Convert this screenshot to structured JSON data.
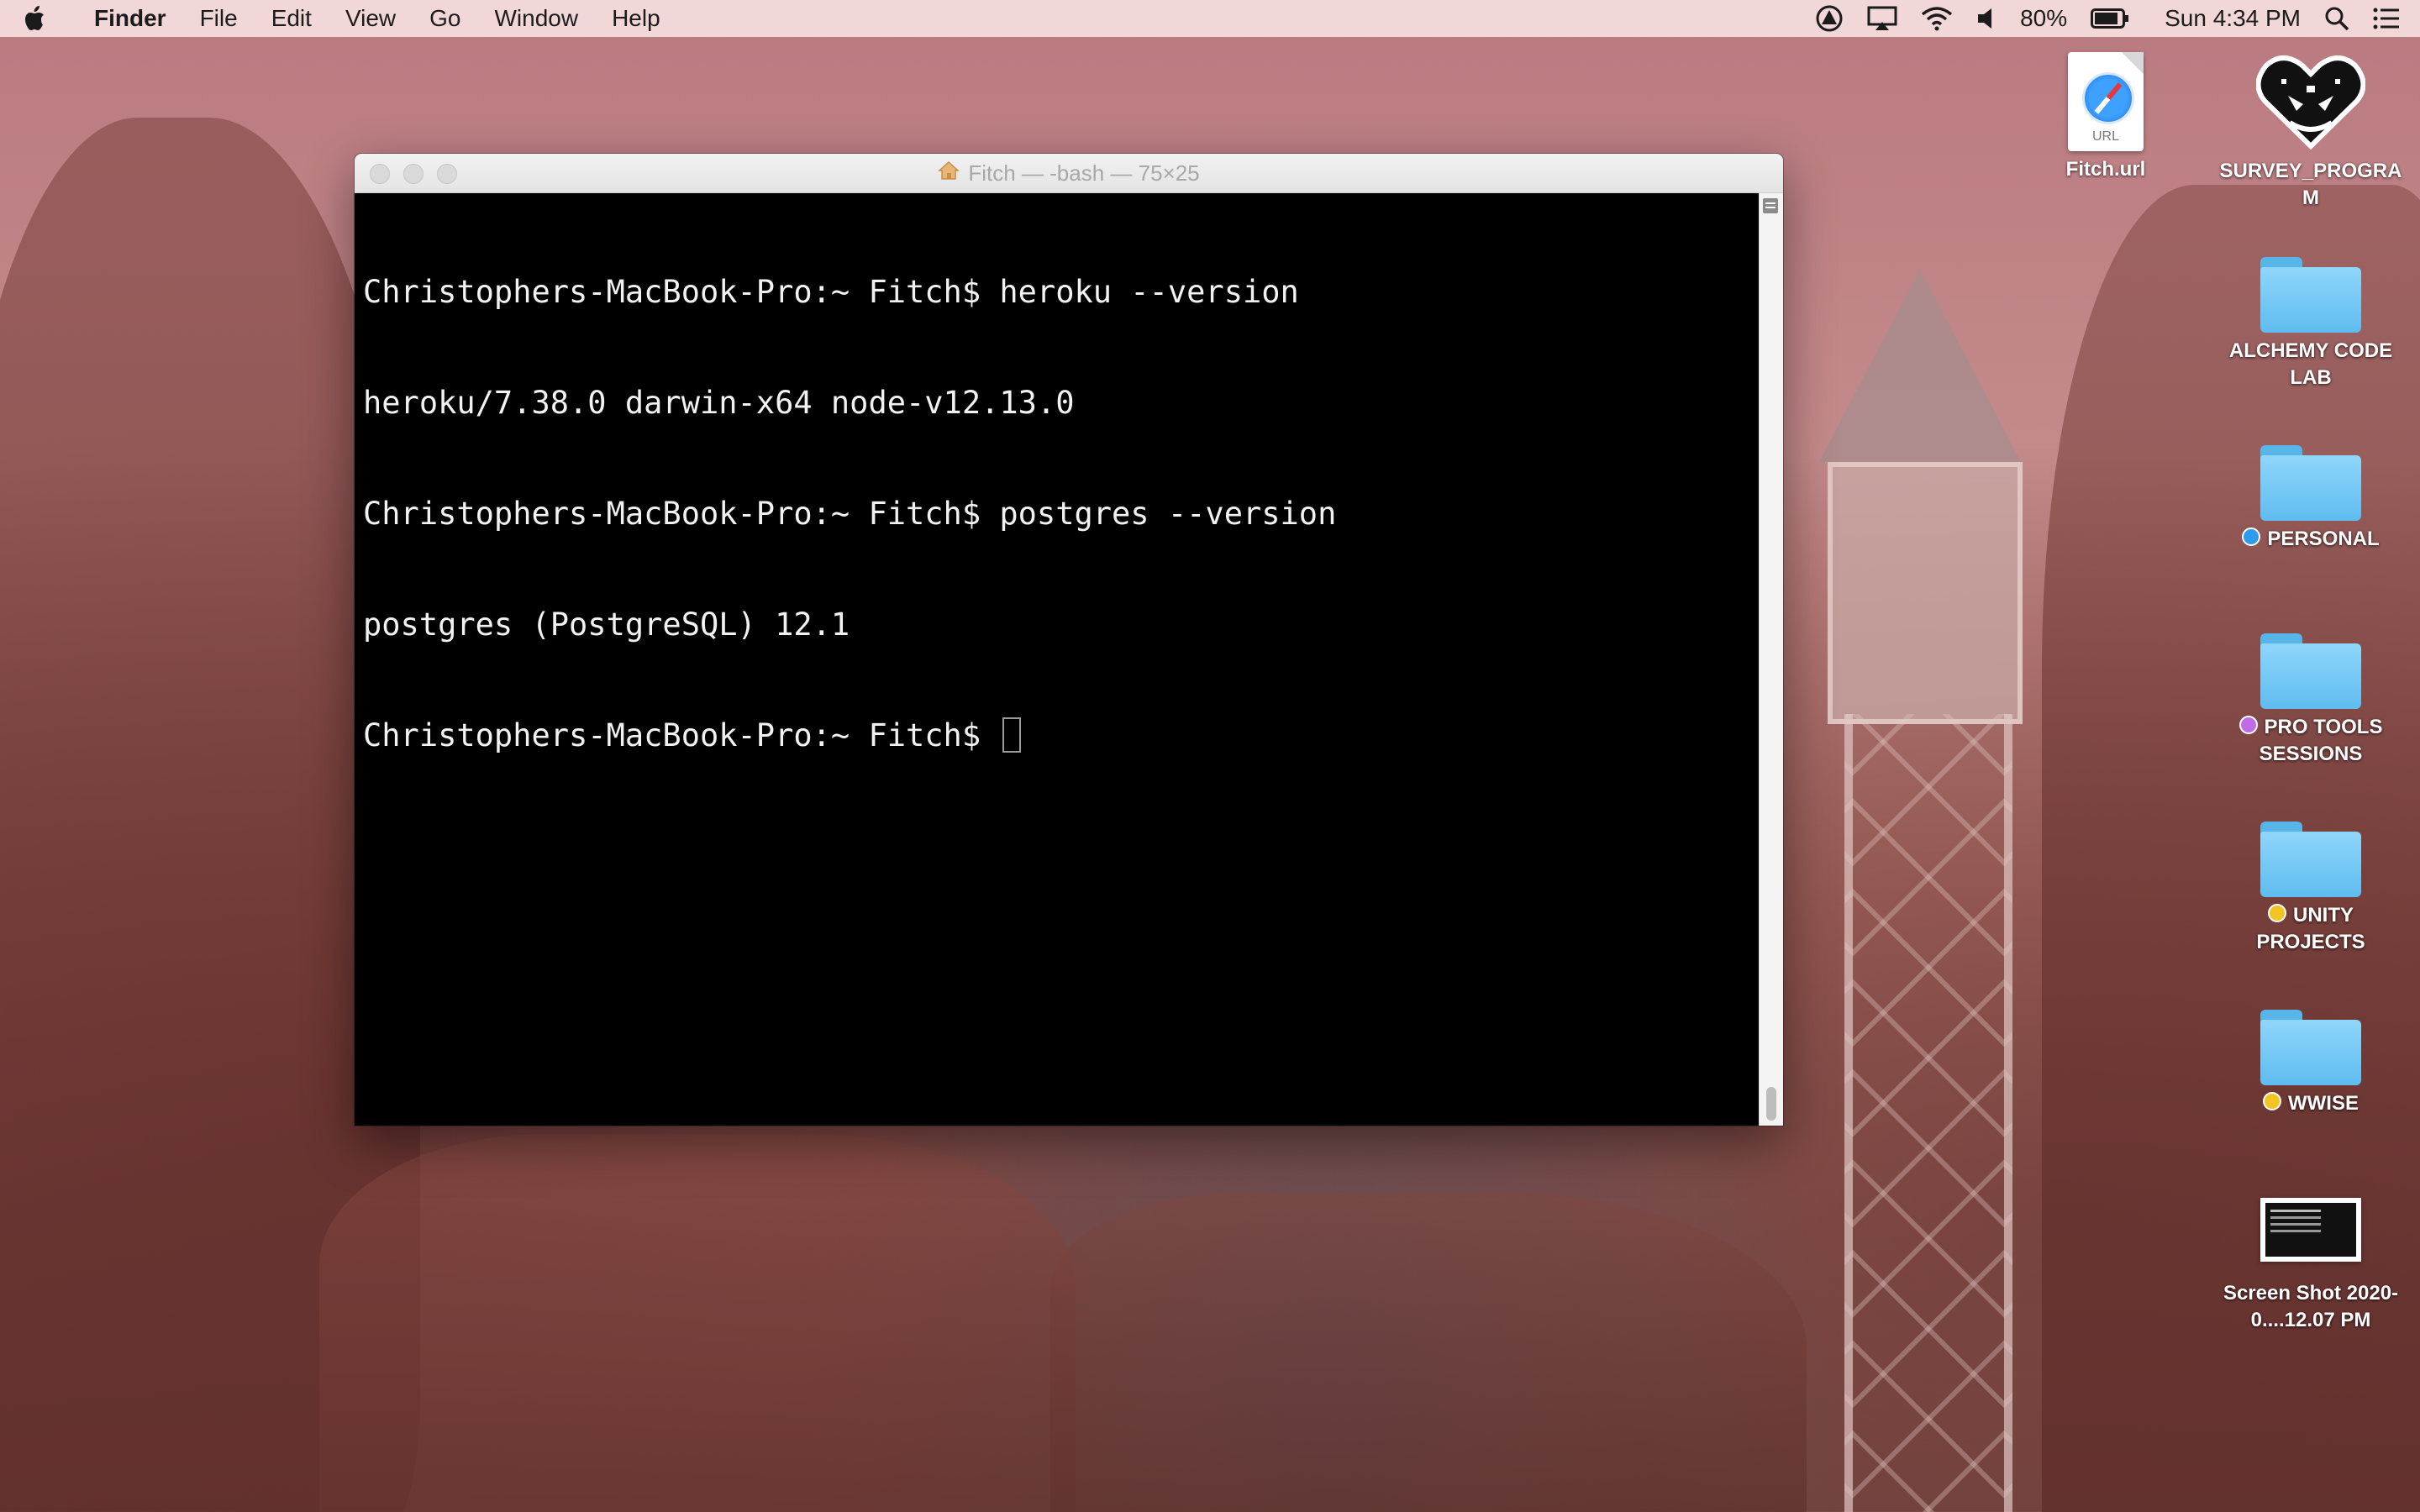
{
  "menubar": {
    "app_name": "Finder",
    "items": [
      "File",
      "Edit",
      "View",
      "Go",
      "Window",
      "Help"
    ],
    "battery_percent": "80%",
    "clock": "Sun 4:34 PM"
  },
  "terminal": {
    "title": "Fitch — -bash — 75×25",
    "lines": [
      "Christophers-MacBook-Pro:~ Fitch$ heroku --version",
      "heroku/7.38.0 darwin-x64 node-v12.13.0",
      "Christophers-MacBook-Pro:~ Fitch$ postgres --version",
      "postgres (PostgreSQL) 12.1",
      "Christophers-MacBook-Pro:~ Fitch$ "
    ]
  },
  "desktop": {
    "icons": [
      {
        "label": "Fitch.url",
        "kind": "url-file",
        "url_badge": "URL"
      },
      {
        "label": "SURVEY_PROGRAM",
        "kind": "heart-app"
      },
      {
        "label": "ALCHEMY CODE LAB",
        "kind": "folder"
      },
      {
        "label": "PERSONAL",
        "kind": "folder",
        "tag_color": "#2f9bef"
      },
      {
        "label": "PRO TOOLS SESSIONS",
        "kind": "folder",
        "tag_color": "#c16ce6"
      },
      {
        "label": "UNITY PROJECTS",
        "kind": "folder",
        "tag_color": "#f4c522"
      },
      {
        "label": "WWISE",
        "kind": "folder",
        "tag_color": "#f4c522"
      },
      {
        "label": "Screen Shot 2020-0....12.07 PM",
        "kind": "screenshot"
      }
    ]
  },
  "colors": {
    "menubar_bg": "#f6dee0",
    "folder_blue": "#6cc4f3",
    "terminal_bg": "#000000",
    "terminal_text": "#f2f2f2"
  }
}
